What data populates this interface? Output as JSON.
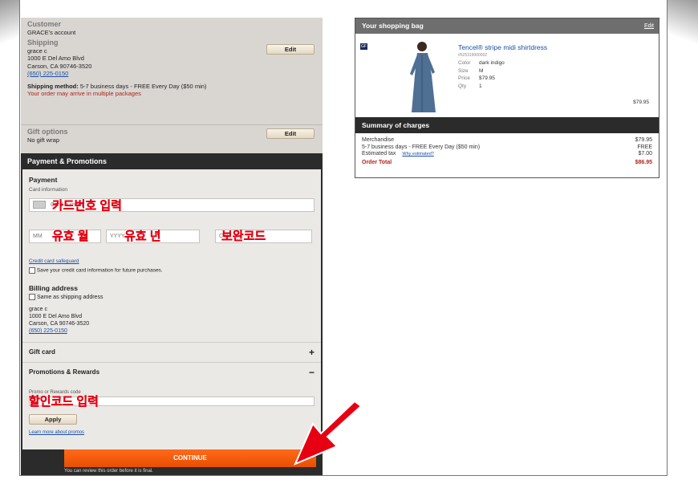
{
  "customer": {
    "title": "Customer",
    "account": "GRACE's account"
  },
  "shipping": {
    "title": "Shipping",
    "edit_label": "Edit",
    "name": "grace c",
    "address1": "1000 E Del Amo Blvd",
    "address2": "Carson, CA  90746-3520",
    "phone": "(650) 225-0150",
    "method_label": "Shipping method:",
    "method_value": "5-7 business days - FREE Every Day ($50 min)",
    "note": "Your order may arrive in multiple packages"
  },
  "gift": {
    "title": "Gift options",
    "edit_label": "Edit",
    "value": "No gift wrap"
  },
  "payment": {
    "header": "Payment & Promotions",
    "title": "Payment",
    "card_info_label": "Card information",
    "card_placeholder": "Card number",
    "mm_placeholder": "MM",
    "yyyy_placeholder": "YYYY",
    "cvv_placeholder": "CVV",
    "safeguard_link": "Credit card safeguard",
    "save_card_label": "Save your credit card information for future purchases.",
    "billing_title": "Billing address",
    "same_as_label": "Same as shipping address",
    "billing_name": "grace c",
    "billing_address1": "1000 E Del Amo Blvd",
    "billing_address2": "Carson, CA  90746-3520",
    "billing_phone": "(650) 225-0150"
  },
  "gift_card": {
    "label": "Gift card",
    "sign": "+"
  },
  "promotions": {
    "label": "Promotions & Rewards",
    "sign": "−",
    "code_label": "Promo or Rewards code",
    "apply_label": "Apply",
    "learn_more": "Learn more about promos"
  },
  "annotations": {
    "card_number": "카드번호 입력",
    "exp_month": "유효 월",
    "exp_year": "유효 년",
    "security_code": "보완코드",
    "promo_code": "할인코드 입력"
  },
  "continue": {
    "label": "CONTINUE",
    "subtext": "You can review this order before it is final."
  },
  "bag": {
    "title": "Your shopping bag",
    "edit_label": "Edit",
    "brand_badge": "GF",
    "item": {
      "name": "Tencel® stripe midi shirtdress",
      "sku": "#525319000002",
      "color_label": "Color",
      "color": "dark indigo",
      "size_label": "Size",
      "size": "M",
      "price_label": "Price",
      "price": "$79.95",
      "qty_label": "Qty",
      "qty": "1",
      "line_total": "$79.95"
    }
  },
  "summary": {
    "title": "Summary of charges",
    "merch_label": "Merchandise",
    "merch_value": "$79.95",
    "ship_label": "5-7 business days - FREE Every Day ($50 min)",
    "ship_value": "FREE",
    "tax_label": "Estimated tax",
    "tax_link": "Why estimated?",
    "tax_value": "$7.00",
    "total_label": "Order Total",
    "total_value": "$86.95"
  },
  "colors": {
    "accent_orange": "#e84f00",
    "annotation_red": "#e60012",
    "header_dark": "#2b2b2b"
  }
}
